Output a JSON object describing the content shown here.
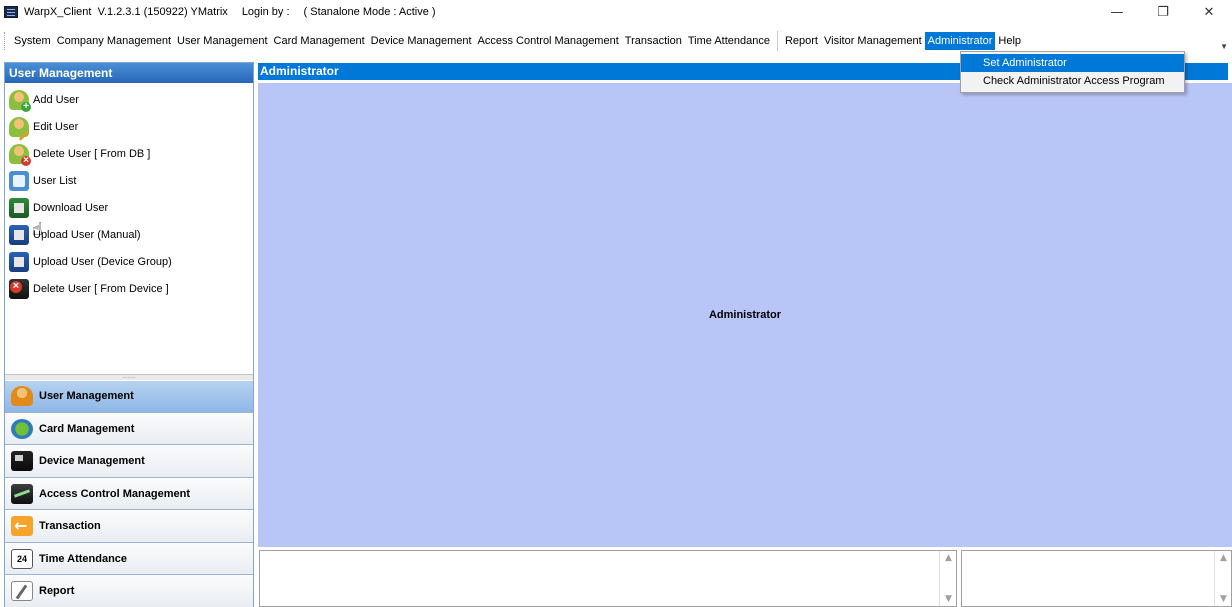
{
  "titlebar": {
    "app_title": "WarpX_Client  V.1.2.3.1 (150922) YMatrix",
    "login_label": "Login by :",
    "mode_text": "( Stanalone Mode : Active )",
    "minimize": "—",
    "restore": "❐",
    "close": "✕"
  },
  "menubar": {
    "items": [
      "System",
      "Company Management",
      "User Management",
      "Card Management",
      "Device Management",
      "Access Control Management",
      "Transaction",
      "Time Attendance",
      "Report",
      "Visitor Management",
      "Administrator",
      "Help"
    ],
    "active": "Administrator"
  },
  "dropdown": {
    "items": [
      "Set Administrator",
      "Check Administrator Access Program"
    ],
    "highlighted": "Set Administrator"
  },
  "left_panel": {
    "title": "User Management",
    "items": [
      {
        "label": "Add User",
        "icon": "add-user-icon"
      },
      {
        "label": "Edit User",
        "icon": "edit-user-icon"
      },
      {
        "label": "Delete User [ From DB ]",
        "icon": "delete-user-icon"
      },
      {
        "label": "User List",
        "icon": "user-list-icon"
      },
      {
        "label": "Download User",
        "icon": "download-user-icon"
      },
      {
        "label": "Upload User (Manual)",
        "icon": "upload-user-icon"
      },
      {
        "label": "Upload User (Device Group)",
        "icon": "upload-user-group-icon"
      },
      {
        "label": "Delete User [ From Device ]",
        "icon": "delete-device-user-icon"
      }
    ],
    "splitter": "........",
    "nav": [
      {
        "label": "User Management",
        "icon": "users-icon",
        "selected": true
      },
      {
        "label": "Card Management",
        "icon": "card-icon",
        "selected": false
      },
      {
        "label": "Device Management",
        "icon": "device-icon",
        "selected": false
      },
      {
        "label": "Access Control Management",
        "icon": "access-control-icon",
        "selected": false
      },
      {
        "label": "Transaction",
        "icon": "transaction-icon",
        "selected": false
      },
      {
        "label": "Time Attendance",
        "icon": "calendar-icon",
        "selected": false
      },
      {
        "label": "Report",
        "icon": "report-icon",
        "selected": false
      }
    ],
    "calendar_day": "24"
  },
  "main": {
    "header": "Administrator",
    "center_label": "Administrator"
  },
  "colors": {
    "accent": "#0078d7",
    "main_bg": "#b7c5f7",
    "nav_selected": "#8fb7e6"
  }
}
